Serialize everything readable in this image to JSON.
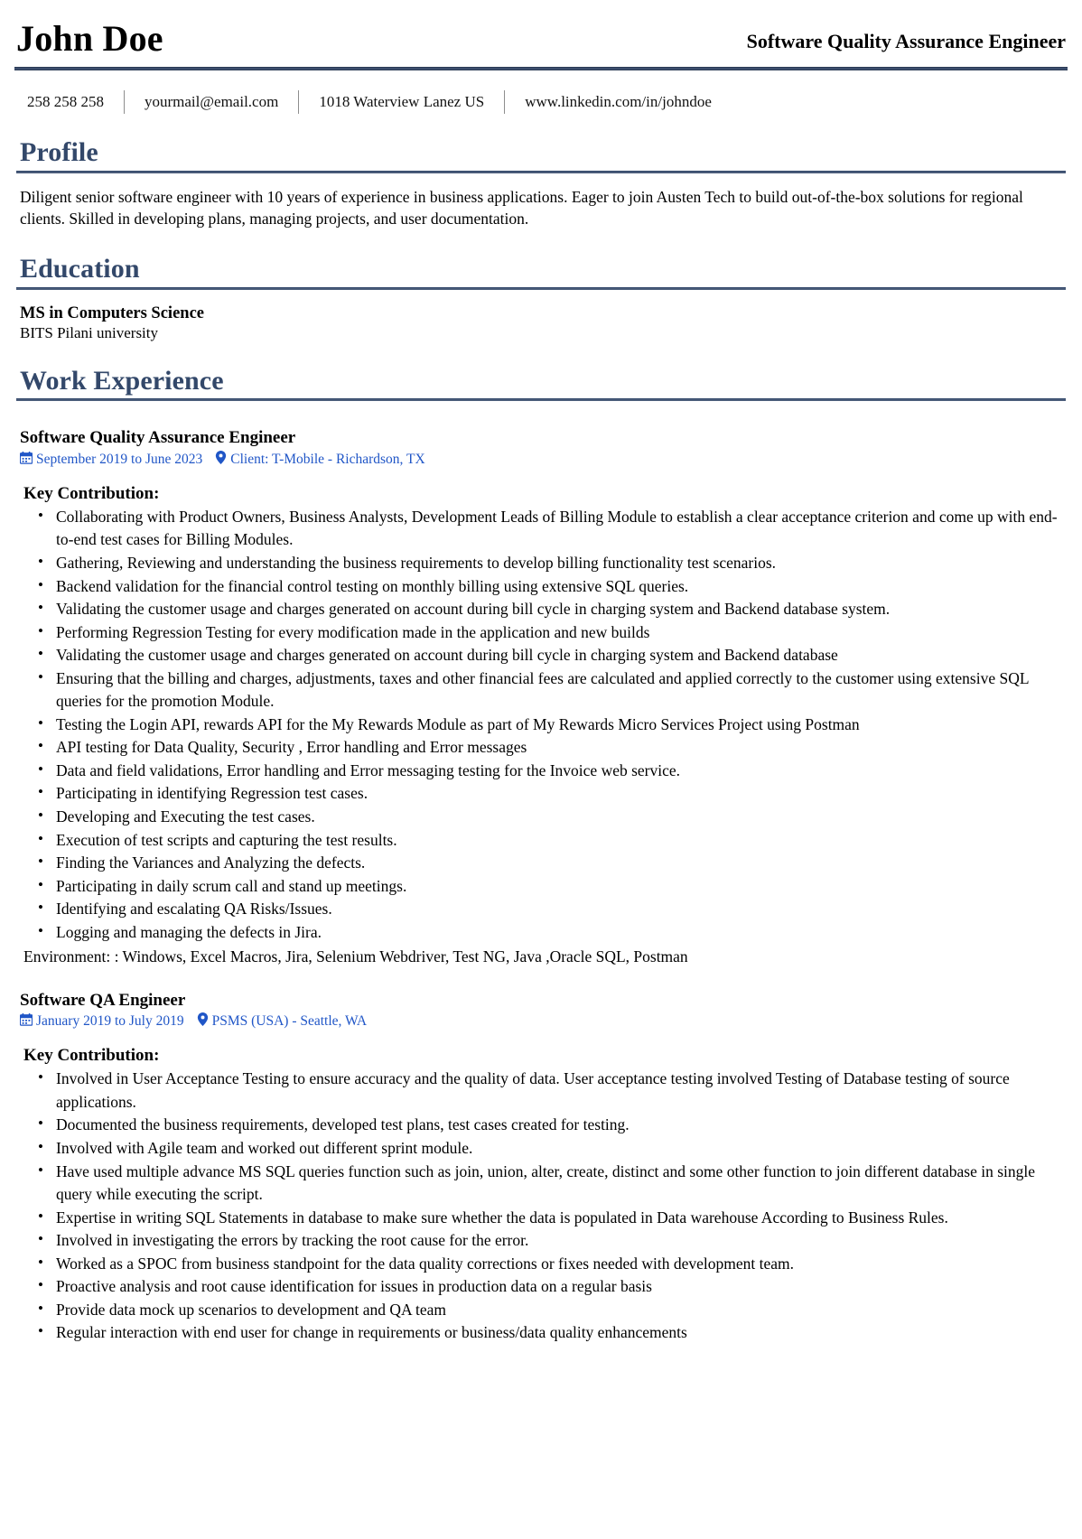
{
  "header": {
    "full_name": "John Doe",
    "headline": "Software Quality Assurance Engineer",
    "accent_color": "#33486a",
    "rule_color": "#3d4f6e",
    "link_color": "#2056c7"
  },
  "contact": {
    "phone": "258 258 258",
    "email": "yourmail@email.com",
    "address": "1018 Waterview Lanez US",
    "linkedin": "www.linkedin.com/in/johndoe"
  },
  "profile": {
    "title": "Profile",
    "text": "Diligent senior software engineer with 10 years of experience in business applications. Eager to join Austen Tech to build out-of-the-box solutions for regional clients. Skilled in developing plans, managing projects, and user documentation."
  },
  "education": {
    "title": "Education",
    "entries": [
      {
        "degree": "MS in Computers Science",
        "school": "BITS Pilani university"
      }
    ]
  },
  "work_experience": {
    "title": "Work Experience",
    "key_contribution_label": "Key Contribution:",
    "jobs": [
      {
        "role": "Software Quality Assurance Engineer",
        "date_icon": "calendar-icon",
        "dates": "September 2019 to June 2023",
        "location_icon": "map-pin-icon",
        "location": "Client: T-Mobile - Richardson, TX",
        "bullets": [
          "Collaborating with Product Owners, Business Analysts, Development Leads of Billing Module to establish a clear acceptance criterion and come up with end-to-end test cases for Billing Modules.",
          "Gathering, Reviewing and understanding the business requirements to develop billing functionality test scenarios.",
          "Backend validation for the financial control testing on monthly billing using extensive SQL queries.",
          "Validating the customer usage and charges generated on account during bill cycle in charging system and Backend database system.",
          "Performing Regression Testing for every modification made in the application and new builds",
          "Validating the customer usage and charges generated on account during bill cycle in charging system and Backend database",
          "Ensuring that the billing and charges, adjustments, taxes and other financial fees are calculated and applied correctly to the customer using extensive SQL queries for the promotion Module.",
          "Testing the Login API, rewards API for the My Rewards Module as part of My Rewards Micro Services Project using Postman",
          "API testing for Data Quality, Security , Error handling and Error messages",
          "Data and field validations, Error handling and Error messaging testing for the Invoice web service.",
          "Participating in identifying Regression test cases.",
          "Developing and Executing the test cases.",
          "Execution of test scripts and capturing the test results.",
          "Finding the Variances and Analyzing the defects.",
          "Participating in daily scrum call and stand up meetings.",
          "Identifying and escalating QA Risks/Issues.",
          "Logging and managing the defects in Jira."
        ],
        "environment": "Environment: : Windows, Excel Macros, Jira, Selenium Webdriver, Test NG, Java ,Oracle SQL, Postman"
      },
      {
        "role": "Software QA Engineer",
        "date_icon": "calendar-icon",
        "dates": "January 2019 to July 2019",
        "location_icon": "map-pin-icon",
        "location": "PSMS (USA) - Seattle, WA",
        "bullets": [
          "Involved in User Acceptance Testing to ensure accuracy and the quality of data. User acceptance testing involved Testing of Database testing of source applications.",
          "Documented the business requirements, developed test plans, test cases created for testing.",
          "Involved with Agile team and worked out different sprint module.",
          "Have used multiple advance MS SQL queries function such as join, union, alter, create, distinct and some other function to join different database in single query while executing the script.",
          "Expertise in writing SQL Statements in database to make sure whether the data is populated in Data warehouse According to Business Rules.",
          "Involved in investigating the errors by tracking the root cause for the error.",
          "Worked as a SPOC from business standpoint for the data quality corrections or fixes needed with development team.",
          "Proactive analysis and root cause identification for issues in production data on a regular basis",
          "Provide data mock up scenarios to development and QA team",
          "Regular interaction with end user for change in requirements or business/data quality enhancements"
        ],
        "environment": ""
      }
    ]
  }
}
